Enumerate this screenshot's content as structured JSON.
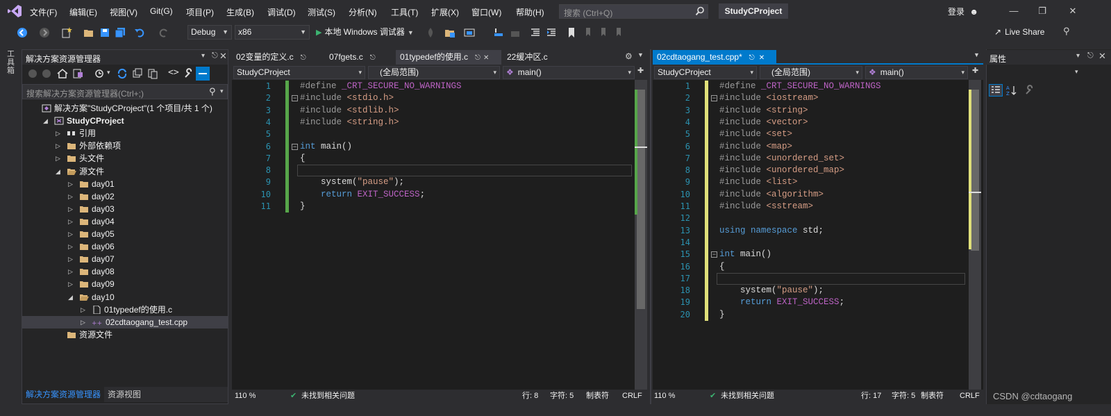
{
  "menu": {
    "items": [
      "文件(F)",
      "编辑(E)",
      "视图(V)",
      "Git(G)",
      "项目(P)",
      "生成(B)",
      "调试(D)",
      "测试(S)",
      "分析(N)",
      "工具(T)",
      "扩展(X)",
      "窗口(W)",
      "帮助(H)"
    ],
    "search_placeholder": "搜索 (Ctrl+Q)",
    "project_title": "StudyCProject",
    "login": "登录"
  },
  "toolbar": {
    "config": "Debug",
    "platform": "x86",
    "run_label": "本地 Windows 调试器",
    "live_share": "Live Share"
  },
  "left_strip": {
    "toolbox": "工具箱"
  },
  "solution_explorer": {
    "title": "解决方案资源管理器",
    "search_placeholder": "搜索解决方案资源管理器(Ctrl+;)",
    "tree": [
      {
        "label": "解决方案\"StudyCProject\"(1 个项目/共 1 个)",
        "expander": "",
        "icon": "solution-icon"
      },
      {
        "label": "StudyCProject",
        "expander": "◢",
        "icon": "project-icon",
        "bold": true
      },
      {
        "label": "引用",
        "expander": "▷",
        "icon": "references-icon"
      },
      {
        "label": "外部依赖项",
        "expander": "▷",
        "icon": "folder-icon"
      },
      {
        "label": "头文件",
        "expander": "▷",
        "icon": "folder-icon"
      },
      {
        "label": "源文件",
        "expander": "◢",
        "icon": "folder-open-icon"
      },
      {
        "label": "day01",
        "expander": "▷",
        "icon": "folder-icon"
      },
      {
        "label": "day02",
        "expander": "▷",
        "icon": "folder-icon"
      },
      {
        "label": "day03",
        "expander": "▷",
        "icon": "folder-icon"
      },
      {
        "label": "day04",
        "expander": "▷",
        "icon": "folder-icon"
      },
      {
        "label": "day05",
        "expander": "▷",
        "icon": "folder-icon"
      },
      {
        "label": "day06",
        "expander": "▷",
        "icon": "folder-icon"
      },
      {
        "label": "day07",
        "expander": "▷",
        "icon": "folder-icon"
      },
      {
        "label": "day08",
        "expander": "▷",
        "icon": "folder-icon"
      },
      {
        "label": "day09",
        "expander": "▷",
        "icon": "folder-icon"
      },
      {
        "label": "day10",
        "expander": "◢",
        "icon": "folder-open-icon"
      },
      {
        "label": "01typedef的使用.c",
        "expander": "▷",
        "icon": "c-file-icon"
      },
      {
        "label": "02cdtaogang_test.cpp",
        "expander": "▷",
        "icon": "cpp-file-icon",
        "selected": true
      },
      {
        "label": "资源文件",
        "expander": "",
        "icon": "folder-icon"
      }
    ],
    "bottom_tabs": [
      "解决方案资源管理器",
      "资源视图"
    ]
  },
  "editor_left": {
    "tabs": [
      "02变量的定义.c",
      "07fgets.c",
      "01typedef的使用.c",
      "22缓冲区.c"
    ],
    "nav": [
      "StudyCProject",
      "(全局范围)",
      "main()"
    ],
    "lines": [
      "#define _CRT_SECURE_NO_WARNINGS",
      "#include <stdio.h>",
      "#include <stdlib.h>",
      "#include <string.h>",
      "",
      "int main()",
      "{",
      "",
      "    system(\"pause\");",
      "    return EXIT_SUCCESS;",
      "}"
    ],
    "status": {
      "zoom": "110 %",
      "issues": "未找到相关问题",
      "line": "行: 8",
      "char": "字符: 5",
      "tab": "制表符",
      "eol": "CRLF"
    }
  },
  "editor_right": {
    "tabs": [
      "02cdtaogang_test.cpp*"
    ],
    "nav": [
      "StudyCProject",
      "(全局范围)",
      "main()"
    ],
    "lines": [
      "#define _CRT_SECURE_NO_WARNINGS",
      "#include <iostream>",
      "#include <string>",
      "#include <vector>",
      "#include <set>",
      "#include <map>",
      "#include <unordered_set>",
      "#include <unordered_map>",
      "#include <list>",
      "#include <algorithm>",
      "#include <sstream>",
      "",
      "using namespace std;",
      "",
      "int main()",
      "{",
      "",
      "    system(\"pause\");",
      "    return EXIT_SUCCESS;",
      "}"
    ],
    "status": {
      "zoom": "110 %",
      "issues": "未找到相关问题",
      "line": "行: 17",
      "char": "字符: 5",
      "tab": "制表符",
      "eol": "CRLF"
    }
  },
  "properties": {
    "title": "属性"
  },
  "watermark": "CSDN @cdtaogang",
  "colors": {
    "accent": "#007acc",
    "keyword": "#569cd6",
    "string": "#d69d85",
    "line_number": "#2b91af",
    "changed_margin": "#e0e07a",
    "saved_margin": "#57a64a"
  }
}
